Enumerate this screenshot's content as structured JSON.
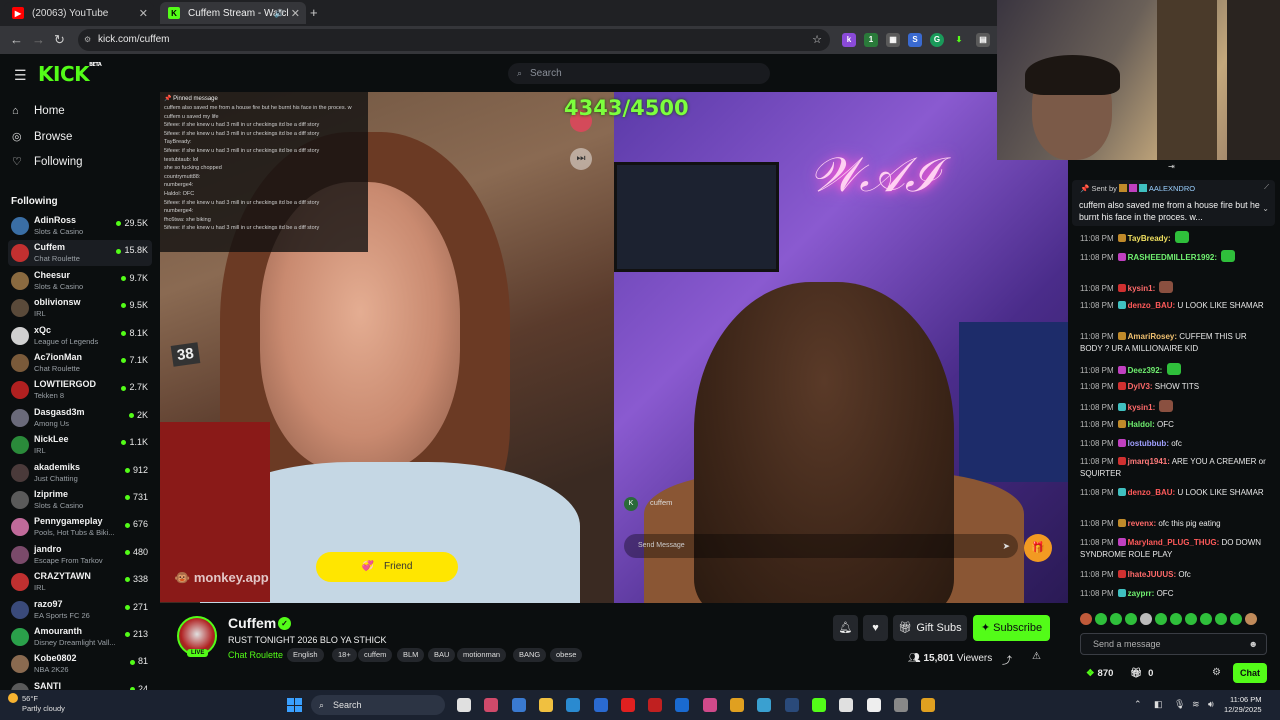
{
  "browser": {
    "tabs": [
      {
        "title": "(20063) YouTube",
        "active": false
      },
      {
        "title": "Cuffem Stream - Watch Live",
        "active": true
      }
    ],
    "url": "kick.com/cuffem",
    "new_tab_icon": "+"
  },
  "site": {
    "logo": "KICK",
    "logo_beta": "BETA",
    "search_placeholder": "Search"
  },
  "sidebar": {
    "nav": [
      {
        "label": "Home",
        "icon": "home-icon"
      },
      {
        "label": "Browse",
        "icon": "compass-icon"
      },
      {
        "label": "Following",
        "icon": "heart-icon"
      }
    ],
    "following_heading": "Following",
    "following": [
      {
        "name": "AdinRoss",
        "category": "Slots & Casino",
        "viewers": "29.5K",
        "color": "#3a6ea5"
      },
      {
        "name": "Cuffem",
        "category": "Chat Roulette",
        "viewers": "15.8K",
        "color": "#c23030",
        "active": true
      },
      {
        "name": "Cheesur",
        "category": "Slots & Casino",
        "viewers": "9.7K",
        "color": "#8a6a40"
      },
      {
        "name": "oblivionsw",
        "category": "IRL",
        "viewers": "9.5K",
        "color": "#5a4a3a"
      },
      {
        "name": "xQc",
        "category": "League of Legends",
        "viewers": "8.1K",
        "color": "#d0d0d0"
      },
      {
        "name": "Ac7ionMan",
        "category": "Chat Roulette",
        "viewers": "7.1K",
        "color": "#7a5a3a"
      },
      {
        "name": "LOWTIERGOD",
        "category": "Tekken 8",
        "viewers": "2.7K",
        "color": "#b02020"
      },
      {
        "name": "Dasgasd3m",
        "category": "Among Us",
        "viewers": "2K",
        "color": "#6a6a7a"
      },
      {
        "name": "NickLee",
        "category": "IRL",
        "viewers": "1.1K",
        "color": "#2a8a3a"
      },
      {
        "name": "akademiks",
        "category": "Just Chatting",
        "viewers": "912",
        "color": "#4a3a3a"
      },
      {
        "name": "Iziprime",
        "category": "Slots & Casino",
        "viewers": "731",
        "color": "#5a5a5a"
      },
      {
        "name": "Pennygameplay",
        "category": "Pools, Hot Tubs & Biki...",
        "viewers": "676",
        "color": "#c06a9a"
      },
      {
        "name": "jandro",
        "category": "Escape From Tarkov",
        "viewers": "480",
        "color": "#7a4a6a"
      },
      {
        "name": "CRAZYTAWN",
        "category": "IRL",
        "viewers": "338",
        "color": "#c03030"
      },
      {
        "name": "razo97",
        "category": "EA Sports FC 26",
        "viewers": "271",
        "color": "#3a4a7a"
      },
      {
        "name": "Amouranth",
        "category": "Disney Dreamlight Vall...",
        "viewers": "213",
        "color": "#2aa04a"
      },
      {
        "name": "Kobe0802",
        "category": "NBA 2K26",
        "viewers": "81",
        "color": "#8a6a50"
      },
      {
        "name": "SANTI",
        "category": "",
        "viewers": "24",
        "color": "#5a5a5a"
      }
    ]
  },
  "video": {
    "counter": "4343/4500",
    "pinned": {
      "title": "Pinned message",
      "lines": [
        "cuffem also saved me from a house fire but he burnt his face in the proces. w",
        "cuffem u saved my life",
        "5ifeee: if she knew u had 3 mill in ur checkings itd be a diff story",
        "5ifeee: if she knew u had 3 mill in ur checkings itd be a diff story",
        "TayBready:",
        "5ifeee: if she knew u had 3 mill in ur checkings itd be a diff story",
        "testubtaub: lol",
        "she so fucking chopped",
        "countrymutt88:",
        "numberge4:",
        "Haldol: OFC",
        "5ifeee: if she knew u had 3 mill in ur checkings itd be a diff story",
        "numberge4:",
        "fhc6twa: she biking",
        "5ifeee: if she knew u had 3 mill in ur checkings itd be a diff story"
      ]
    },
    "friend_button": "Friend",
    "watermark": "monkey.app",
    "badge": "38",
    "cam_user": "cuffem",
    "cam_user_initial": "K",
    "send_placeholder": "Send Message"
  },
  "stream_info": {
    "channel": "Cuffem",
    "title": "RUST TONIGHT 2026 BLO YA STHICK",
    "category": "Chat Roulette",
    "tags": [
      "English",
      "18+",
      "cuffem",
      "BLM",
      "BAU",
      "motionman",
      "BANG",
      "obese"
    ],
    "live_label": "LIVE",
    "gift_subs": "Gift Subs",
    "subscribe": "Subscribe",
    "viewers_count": "15,801",
    "viewers_label": "Viewers"
  },
  "chat": {
    "pinned": {
      "sent_by_label": "Sent by",
      "sender": "AALEXNDRO",
      "text": "cuffem also saved me from a house fire but he burnt his face in the proces. w..."
    },
    "messages": [
      {
        "time": "11:08 PM",
        "user": "TayBready:",
        "text": "",
        "color": "#f0e060",
        "emote": true
      },
      {
        "time": "11:08 PM",
        "user": "RASHEEDMILLER1992:",
        "text": "",
        "color": "#70f070",
        "emote": true
      },
      {
        "time": "11:08 PM",
        "user": "kysin1:",
        "text": "",
        "color": "#ff6a6a",
        "emote": true
      },
      {
        "time": "11:08 PM",
        "user": "denzo_BAU:",
        "text": "U LOOK LIKE SHAMAR",
        "color": "#ff5a5a",
        "emote": false
      },
      {
        "time": "11:08 PM",
        "user": "AmariRosey:",
        "text": "CUFFEM THIS UR BODY ? UR A MILLIONAIRE KID",
        "color": "#f0c070",
        "emote": false
      },
      {
        "time": "11:08 PM",
        "user": "Deez392:",
        "text": "",
        "color": "#70f070",
        "emote": true
      },
      {
        "time": "11:08 PM",
        "user": "DylV3:",
        "text": "SHOW TITS",
        "color": "#ff6a6a",
        "emote": false
      },
      {
        "time": "11:08 PM",
        "user": "kysin1:",
        "text": "",
        "color": "#ff6a6a",
        "emote": true
      },
      {
        "time": "11:08 PM",
        "user": "Haldol:",
        "text": "OFC",
        "color": "#70f070",
        "emote": false
      },
      {
        "time": "11:08 PM",
        "user": "lostubbub:",
        "text": "ofc",
        "color": "#a0a0ff",
        "emote": false
      },
      {
        "time": "11:08 PM",
        "user": "jmarq1941:",
        "text": "ARE YOU A CREAMER or SQUIRTER",
        "color": "#ff7a7a",
        "emote": false
      },
      {
        "time": "11:08 PM",
        "user": "denzo_BAU:",
        "text": "U LOOK LIKE SHAMAR",
        "color": "#ff5a5a",
        "emote": false
      },
      {
        "time": "11:08 PM",
        "user": "revenx:",
        "text": "ofc this pig eating",
        "color": "#ff6a6a",
        "emote": false
      },
      {
        "time": "11:08 PM",
        "user": "Maryland_PLUG_THUG:",
        "text": "DO DOWN SYNDROME ROLE PLAY",
        "color": "#ff5a5a",
        "emote": false
      },
      {
        "time": "11:08 PM",
        "user": "lhateJUUUS:",
        "text": "Ofc",
        "color": "#ff6a6a",
        "emote": false
      },
      {
        "time": "11:08 PM",
        "user": "zayprr:",
        "text": "OFC",
        "color": "#70f070",
        "emote": false
      }
    ],
    "input_placeholder": "Send a message",
    "points": "870",
    "gifts": "0",
    "chat_button": "Chat"
  },
  "taskbar": {
    "weather_temp": "56°F",
    "weather_desc": "Partly cloudy",
    "search_label": "Search",
    "time": "11:06 PM",
    "date": "12/29/2025"
  }
}
